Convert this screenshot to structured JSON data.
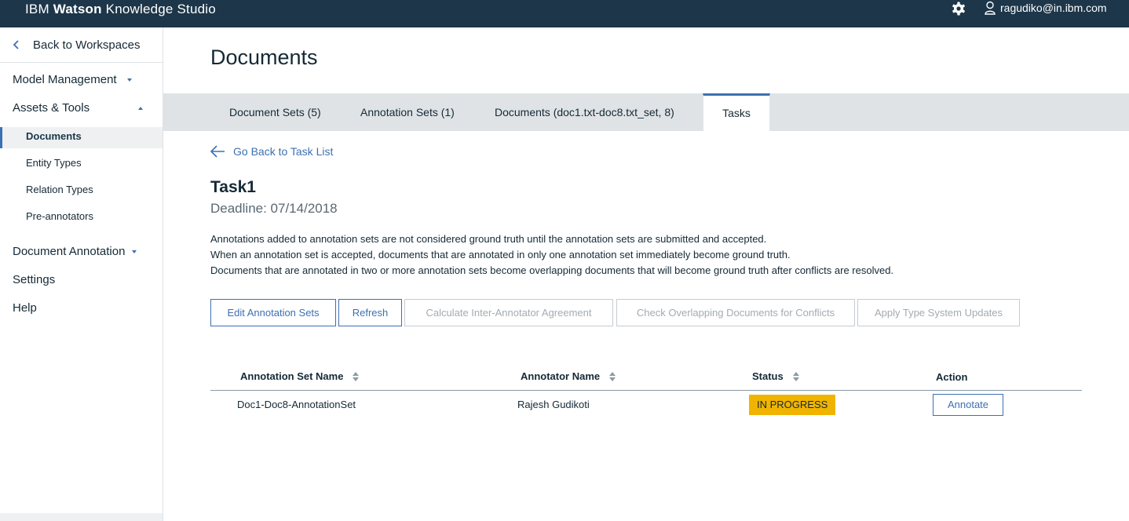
{
  "app": {
    "brand_prefix": "IBM",
    "brand_bold": "Watson",
    "brand_suffix": "Knowledge Studio"
  },
  "header": {
    "user_email": "ragudiko@in.ibm.com",
    "settings_icon": "gear-icon",
    "user_icon": "user-icon"
  },
  "sidebar": {
    "back_label": "Back to Workspaces",
    "sections": {
      "model_management": "Model Management",
      "assets_tools": "Assets & Tools",
      "document_annotation": "Document Annotation",
      "settings": "Settings",
      "help": "Help"
    },
    "sub_items": [
      "Documents",
      "Entity Types",
      "Relation Types",
      "Pre-annotators"
    ],
    "active_sub_item": "Documents"
  },
  "main": {
    "page_title": "Documents",
    "tabs": [
      {
        "label": "Document Sets (5)"
      },
      {
        "label": "Annotation Sets (1)"
      },
      {
        "label": "Documents (doc1.txt-doc8.txt_set, 8)"
      },
      {
        "label": "Tasks"
      }
    ],
    "selected_tab": "Tasks",
    "go_back_label": "Go Back to Task List",
    "task": {
      "name": "Task1",
      "deadline": "Deadline: 07/14/2018",
      "description": [
        "Annotations added to annotation sets are not considered ground truth until the annotation sets are submitted and accepted.",
        "When an annotation set is accepted, documents that are annotated in only one annotation set immediately become ground truth.",
        "Documents that are annotated in two or more annotation sets become overlapping documents that will become ground truth after conflicts are resolved."
      ]
    },
    "buttons": {
      "edit_annotation_sets": "Edit Annotation Sets",
      "refresh": "Refresh",
      "calculate_iaa": "Calculate Inter-Annotator Agreement",
      "check_overlapping": "Check Overlapping Documents for Conflicts",
      "apply_type_system": "Apply Type System Updates"
    },
    "table": {
      "columns": [
        "Annotation Set Name",
        "Annotator Name",
        "Status",
        "Action"
      ],
      "rows": [
        {
          "set_name": "Doc1-Doc8-AnnotationSet",
          "annotator": "Rajesh Gudikoti",
          "status": "IN PROGRESS",
          "action": "Annotate"
        }
      ]
    }
  },
  "colors": {
    "topbar": "#1d3649",
    "accent": "#3d70b2",
    "status_in_progress": "#f0b400",
    "tabbar": "#dfe3e6"
  }
}
